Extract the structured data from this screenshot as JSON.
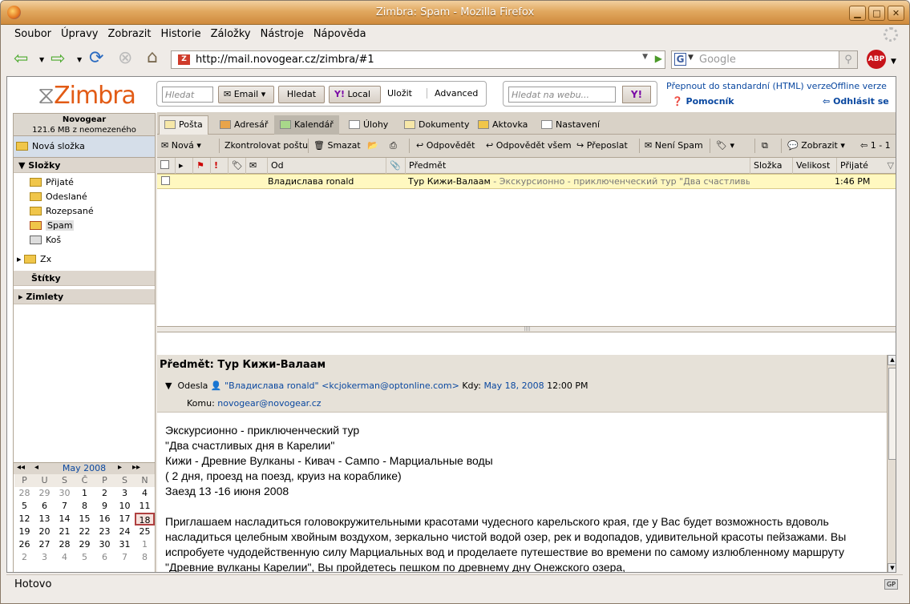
{
  "window": {
    "title": "Zimbra: Spam - Mozilla Firefox"
  },
  "menu": [
    "Soubor",
    "Úpravy",
    "Zobrazit",
    "Historie",
    "Záložky",
    "Nástroje",
    "Nápověda"
  ],
  "nav": {
    "url": "http://mail.novogear.cz/zimbra/#1",
    "search_placeholder": "Google"
  },
  "zimbra": {
    "logo": "Zimbra",
    "search": {
      "placeholder": "Hledat",
      "type_label": "Email",
      "search_btn": "Hledat",
      "local_btn": "Local",
      "save": "Uložit",
      "advanced": "Advanced"
    },
    "web_search_placeholder": "Hledat na webu...",
    "links": {
      "html_version": "Přepnout do standardní (HTML) verze",
      "offline": "Offline verze",
      "help": "Pomocník",
      "logout": "Odhlásit se"
    }
  },
  "account": {
    "name": "Novogear",
    "quota": "121.6 MB z neomezeného"
  },
  "left": {
    "new_folder": "Nová složka",
    "folders_header": "Složky",
    "folders": [
      "Přijaté",
      "Odeslané",
      "Rozepsané",
      "Spam",
      "Koš"
    ],
    "extra_folder": "Zx",
    "tags_header": "Štítky",
    "zimlets_header": "Zimlety"
  },
  "calendar": {
    "month": "May 2008",
    "dow": [
      "P",
      "U",
      "S",
      "Č",
      "P",
      "S",
      "N"
    ],
    "weeks": [
      [
        "28",
        "29",
        "30",
        "1",
        "2",
        "3",
        "4"
      ],
      [
        "5",
        "6",
        "7",
        "8",
        "9",
        "10",
        "11"
      ],
      [
        "12",
        "13",
        "14",
        "15",
        "16",
        "17",
        "18"
      ],
      [
        "19",
        "20",
        "21",
        "22",
        "23",
        "24",
        "25"
      ],
      [
        "26",
        "27",
        "28",
        "29",
        "30",
        "31",
        "1"
      ],
      [
        "2",
        "3",
        "4",
        "5",
        "6",
        "7",
        "8"
      ]
    ],
    "today": "18"
  },
  "tabs": [
    "Pošta",
    "Adresář",
    "Kalendář",
    "Úlohy",
    "Dokumenty",
    "Aktovka",
    "Nastavení"
  ],
  "toolbar": {
    "new": "Nová",
    "check": "Zkontrolovat poštu",
    "delete": "Smazat",
    "reply": "Odpovědět",
    "reply_all": "Odpovědět všem",
    "forward": "Přeposlat",
    "not_spam": "Není Spam",
    "view": "Zobrazit",
    "pager": "1 - 1"
  },
  "columns": {
    "from": "Od",
    "subject": "Předmět",
    "folder": "Složka",
    "size": "Velikost",
    "received": "Přijaté"
  },
  "messages": [
    {
      "from": "Владислава ronald",
      "subject": "Тур Кижи-Валаам",
      "fragment": " - Экскурсионно - приключенческий тур \"Два счастливых дня в К",
      "time": "1:46 PM"
    }
  ],
  "reading": {
    "subject_label": "Předmět:",
    "subject": "Тур Кижи-Валаам",
    "sender_label": "Odesla",
    "sender": "\"Владислава ronald\" <kcjokerman@optonline.com>",
    "date_label": "Kdy:",
    "date": "May 18, 2008",
    "time": "12:00 PM",
    "to_label": "Komu:",
    "to": "novogear@novogear.cz",
    "body": [
      "Экскурсионно - приключенческий тур",
      "\"Два счастливых дня в Карелии\"",
      "Кижи - Древние Вулканы - Кивач - Сампо - Марциальные воды",
      "( 2 дня, проезд на поезд, круиз на кораблике)",
      "Заезд 13 -16 июня 2008",
      "",
      "Приглашаем  насладиться головокружительными красотами чудесного карельского края, где  у Вас будет возможность вдоволь насладиться целебным хвойным воздухом, зеркально чистой водой озер, рек и водопадов, удивительной красоты пейзажами.  Вы испробуете чудодейственную силу Марциальных вод и проделаете путешествие во времени по самому излюбленному маршруту \"Древние вулканы Карелии\", Вы пройдетесь пешком по древнему  дну Онежского озера,"
    ]
  },
  "status": "Hotovo",
  "status_badge": "GP"
}
